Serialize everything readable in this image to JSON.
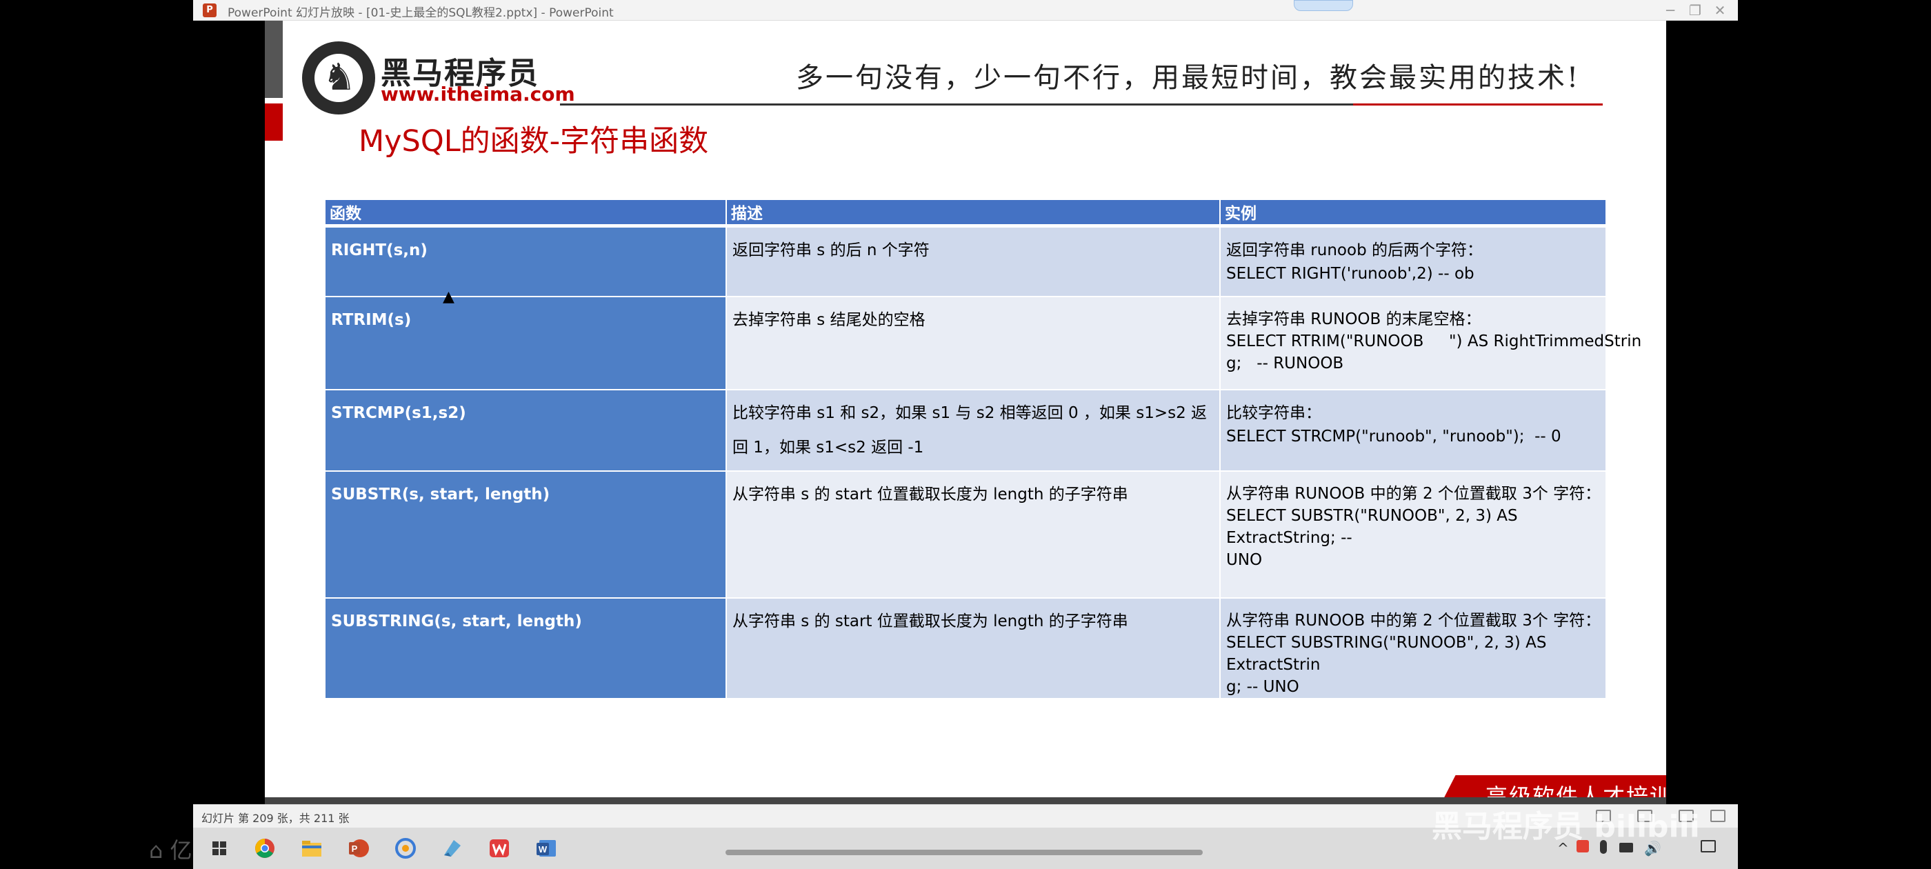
{
  "window": {
    "title": "PowerPoint 幻灯片放映 - [01-史上最全的SQL教程2.pptx] - PowerPoint",
    "controls": [
      "─",
      "❐",
      "✕"
    ]
  },
  "slide": {
    "logo_cn": "黑马程序员",
    "logo_url": "www.itheima.com",
    "slogan": "多一句没有，少一句不行，用最短时间，教会最实用的技术!",
    "title": "MySQL的函数-字符串函数",
    "brand_banner": "高级软件人才培训专家",
    "table": {
      "headers": [
        "函数",
        "描述",
        "实例"
      ],
      "rows": [
        {
          "fn": "RIGHT(s,n)",
          "desc": "返回字符串 s 的后 n 个字符",
          "example": [
            "返回字符串 runoob 的后两个字符：",
            "SELECT RIGHT('runoob',2) -- ob"
          ]
        },
        {
          "fn": "RTRIM(s)",
          "desc": "去掉字符串 s 结尾处的空格",
          "example": [
            "去掉字符串 RUNOOB 的末尾空格：",
            "SELECT RTRIM(\"RUNOOB     \") AS RightTrimmedStrin",
            "g;   -- RUNOOB"
          ]
        },
        {
          "fn": "STRCMP(s1,s2)",
          "desc": "比较字符串 s1 和 s2，如果 s1 与 s2 相等返回 0 ，如果 s1>s2 返回 1，如果 s1<s2 返回 -1",
          "example": [
            "比较字符串：",
            "SELECT STRCMP(\"runoob\", \"runoob\");  -- 0"
          ]
        },
        {
          "fn": "SUBSTR(s, start, length)",
          "desc": "从字符串 s 的 start 位置截取长度为 length 的子字符串",
          "example": [
            "从字符串 RUNOOB 中的第 2 个位置截取 3个 字符：",
            "SELECT SUBSTR(\"RUNOOB\", 2, 3) AS ExtractString; --",
            "UNO"
          ]
        },
        {
          "fn": "SUBSTRING(s, start, length)",
          "desc": "从字符串 s 的 start 位置截取长度为 length 的子字符串",
          "example": [
            "从字符串 RUNOOB 中的第 2 个位置截取 3个 字符：",
            "SELECT SUBSTRING(\"RUNOOB\", 2, 3) AS ExtractStrin",
            "g; -- UNO"
          ]
        }
      ]
    }
  },
  "statusbar": {
    "slide_count": "幻灯片 第 209 张，共 211 张"
  },
  "taskbar": {
    "apps": [
      "windows-start-icon",
      "chrome-icon",
      "file-explorer-icon",
      "powerpoint-icon",
      "app-icon",
      "app-icon",
      "wps-icon",
      "word-icon"
    ],
    "tray": [
      "^"
    ]
  },
  "overlay": {
    "left_watermark": "⌂ 亿正在看",
    "right_watermark": "黑马程序员 bilibili"
  },
  "colors": {
    "header_blue": "#4472c4",
    "fn_cell_blue": "#4e7fc6",
    "row_light": "#cfd9ec",
    "row_lighter": "#e9edf5",
    "accent_red": "#c00000"
  }
}
